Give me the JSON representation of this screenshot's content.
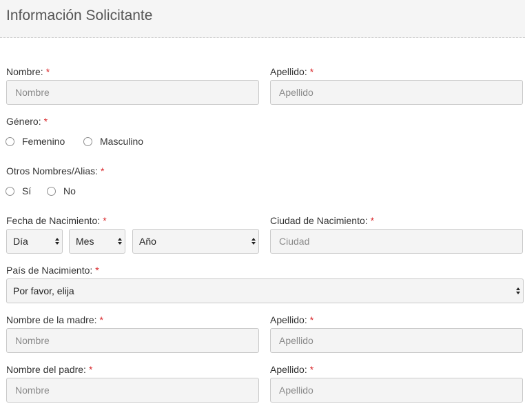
{
  "header": {
    "title": "Información Solicitante"
  },
  "required_mark": "*",
  "nombre": {
    "label": "Nombre:",
    "placeholder": "Nombre"
  },
  "apellido": {
    "label": "Apellido:",
    "placeholder": "Apellido"
  },
  "genero": {
    "label": "Género:",
    "options": [
      "Femenino",
      "Masculino"
    ]
  },
  "alias": {
    "label": "Otros Nombres/Alias:",
    "options": [
      "Sí",
      "No"
    ]
  },
  "fecha": {
    "label": "Fecha de Nacimiento:",
    "dia": "Día",
    "mes": "Mes",
    "anio": "Año"
  },
  "ciudad": {
    "label": "Ciudad de Nacimiento:",
    "placeholder": "Ciudad"
  },
  "pais": {
    "label": "País de Nacimiento:",
    "selected": "Por favor, elija"
  },
  "madre": {
    "label": "Nombre de la madre:",
    "placeholder": "Nombre",
    "apellido_label": "Apellido:",
    "apellido_placeholder": "Apellido"
  },
  "padre": {
    "label": "Nombre del padre:",
    "placeholder": "Nombre",
    "apellido_label": "Apellido:",
    "apellido_placeholder": "Apellido"
  }
}
